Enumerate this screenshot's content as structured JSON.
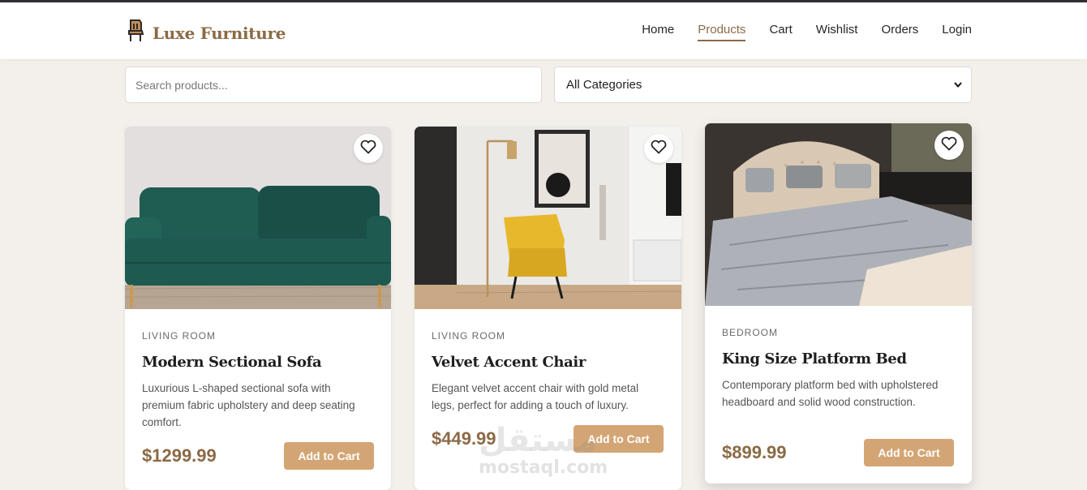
{
  "header": {
    "brand": "Luxe Furniture",
    "nav": [
      {
        "label": "Home",
        "active": false
      },
      {
        "label": "Products",
        "active": true
      },
      {
        "label": "Cart",
        "active": false
      },
      {
        "label": "Wishlist",
        "active": false
      },
      {
        "label": "Orders",
        "active": false
      },
      {
        "label": "Login",
        "active": false
      }
    ]
  },
  "filters": {
    "search_placeholder": "Search products...",
    "category_selected": "All Categories"
  },
  "products": [
    {
      "category": "LIVING ROOM",
      "title": "Modern Sectional Sofa",
      "description": "Luxurious L-shaped sectional sofa with premium fabric upholstery and deep seating comfort.",
      "price": "$1299.99",
      "button": "Add to Cart"
    },
    {
      "category": "LIVING ROOM",
      "title": "Velvet Accent Chair",
      "description": "Elegant velvet accent chair with gold metal legs, perfect for adding a touch of luxury.",
      "price": "$449.99",
      "button": "Add to Cart"
    },
    {
      "category": "BEDROOM",
      "title": "King Size Platform Bed",
      "description": "Contemporary platform bed with upholstered headboard and solid wood construction.",
      "price": "$899.99",
      "button": "Add to Cart"
    }
  ],
  "watermark": {
    "arabic": "مستقل",
    "latin": "mostaql.com"
  },
  "colors": {
    "accent": "#8b6a45",
    "button": "#d4a574",
    "background": "#f3f0eb"
  }
}
